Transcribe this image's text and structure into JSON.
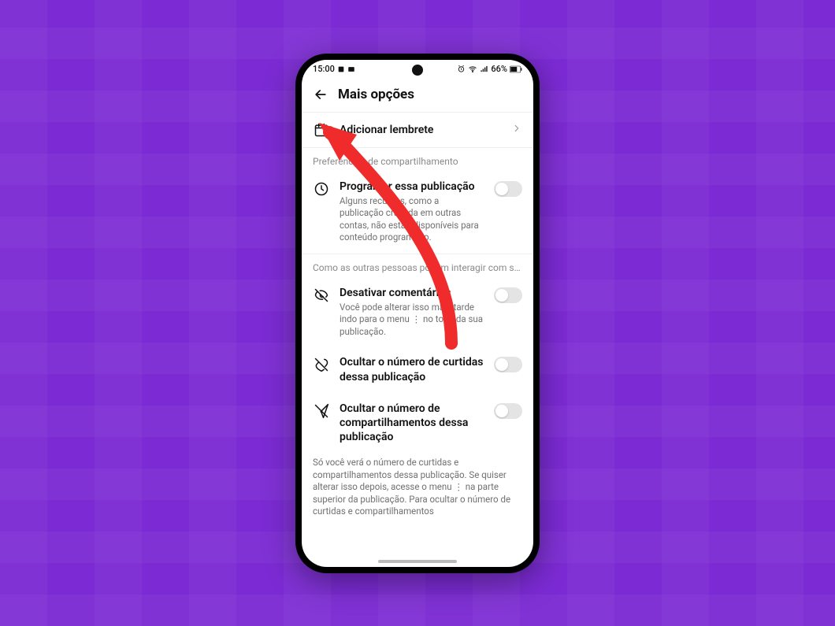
{
  "status_bar": {
    "time": "15:00",
    "battery_text": "66%"
  },
  "header": {
    "title": "Mais opções"
  },
  "reminder_row": {
    "label": "Adicionar lembrete"
  },
  "section_schedule_label": "Preferências de compartilhamento",
  "setting_schedule": {
    "title": "Programar essa publicação",
    "desc": "Alguns recursos, como a publicação cruzada em outras contas, não estão disponíveis para conteúdo programado."
  },
  "section_interact_label": "Como as outras pessoas podem interagir com s…",
  "setting_comments": {
    "title": "Desativar comentários",
    "desc": "Você pode alterar isso mais tarde indo para o menu ⋮ no topo da sua publicação."
  },
  "setting_likes": {
    "title": "Ocultar o número de curtidas dessa publicação"
  },
  "setting_shares": {
    "title": "Ocultar o número de compartilhamentos dessa publicação"
  },
  "footnote": "Só você verá o número de curtidas e compartilhamentos dessa publicação. Se quiser alterar isso depois, acesse o menu ⋮ na parte superior da publicação. Para ocultar o número de curtidas e compartilhamentos"
}
